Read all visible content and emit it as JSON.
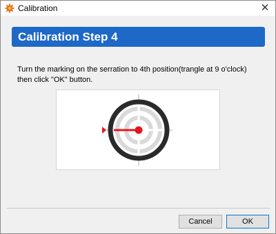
{
  "window": {
    "title": "Calibration",
    "close_glyph": "✕"
  },
  "header": {
    "title": "Calibration Step 4",
    "background": "#1e68c7"
  },
  "instruction": {
    "line1": "Turn the marking on the serration to 4th position(trangle at 9 o'clock)",
    "line2": "then click \"OK\" button."
  },
  "figure": {
    "indicator_position": "9 o'clock",
    "marker_color": "#e8141c",
    "ring_color": "#2a2a2a",
    "crosshair_color": "#d9d9d9"
  },
  "buttons": {
    "cancel_label": "Cancel",
    "ok_label": "OK"
  }
}
